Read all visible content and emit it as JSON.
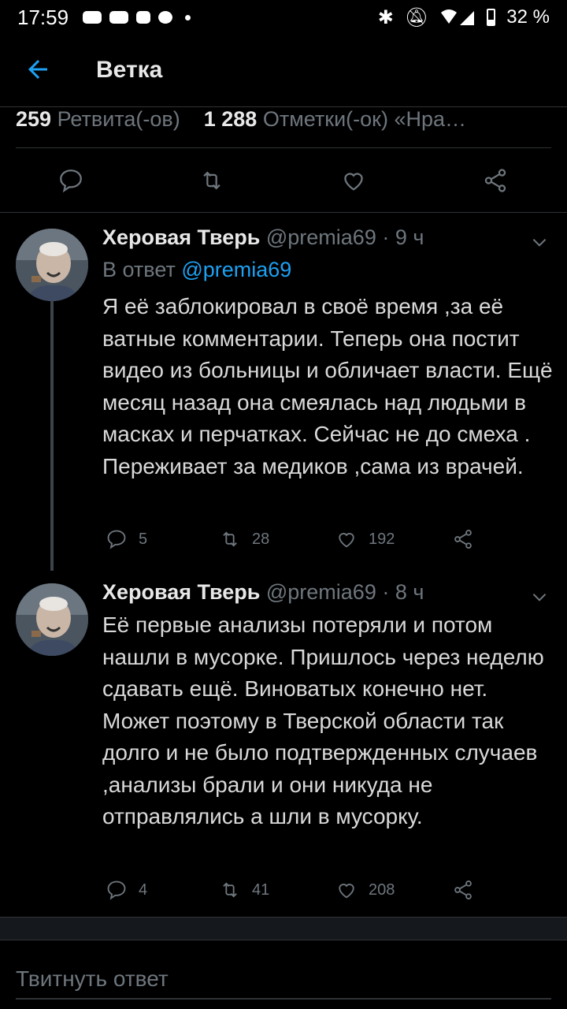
{
  "status_bar": {
    "time": "17:59",
    "battery": "32 %"
  },
  "header": {
    "title": "Ветка"
  },
  "stats": {
    "retweets_count": "259",
    "retweets_label": "Ретвита(-ов)",
    "likes_count": "1 288",
    "likes_label": "Отметки(-ок) «Нра…"
  },
  "tweets": [
    {
      "name": "Херовая Тверь",
      "handle": "@premia69 · 9 ч",
      "reply_prefix": "В ответ",
      "reply_handle": "@premia69",
      "text": "Я её заблокировал в своё время ,за её ватные комментарии. Теперь она постит видео из больницы и обличает власти. Ещё месяц назад она смеялась над людьми в масках и перчатках. Сейчас не до смеха . Переживает за медиков ,сама из врачей.",
      "replies": "5",
      "retweets": "28",
      "likes": "192"
    },
    {
      "name": "Херовая Тверь",
      "handle": "@premia69 · 8 ч",
      "text": "Её первые анализы потеряли и потом нашли в мусорке. Пришлось через неделю сдавать ещё. Виноватых конечно нет. Может поэтому в Тверской области так долго и не было подтвержденных случаев ,анализы брали и они никуда не отправлялись а шли в мусорку.",
      "replies": "4",
      "retweets": "41",
      "likes": "208"
    }
  ],
  "composer": {
    "placeholder": "Твитнуть ответ"
  },
  "colors": {
    "accent": "#1da1f2",
    "muted": "#6e767d",
    "background": "#000000",
    "divider": "#2f3336"
  }
}
